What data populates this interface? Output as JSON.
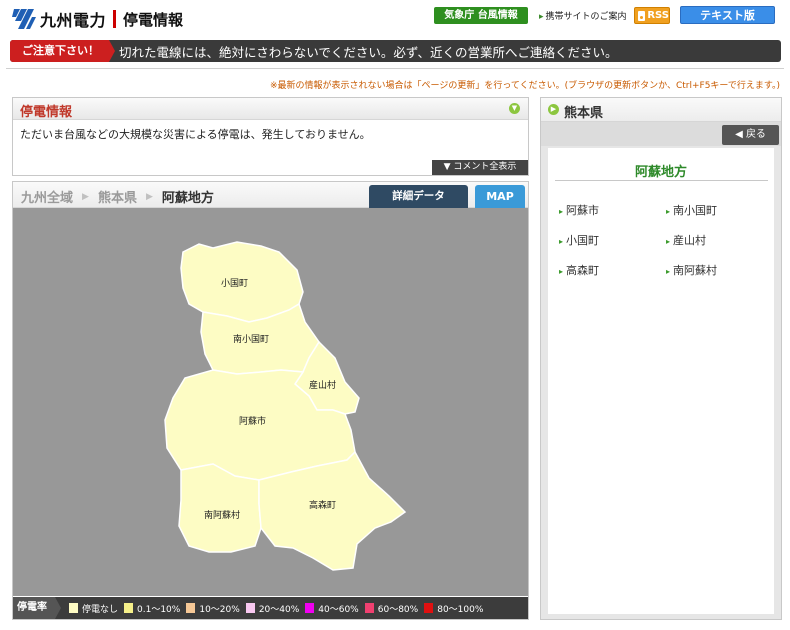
{
  "header": {
    "logo_text": "九州電力",
    "logo_sub": "停電情報",
    "jma_button": "気象庁 台風情報",
    "mobile_link": "携帯サイトのご案内",
    "rss_label": "RSS",
    "text_version_button": "テキスト版"
  },
  "warning": {
    "tag": "ご注意下さい！",
    "message": "切れた電線には、絶対にさわらないでください。必ず、近くの営業所へご連絡ください。"
  },
  "notice": "※最新の情報が表示されない場合は「ページの更新」を行ってください。(ブラウザの更新ボタンか、Ctrl+F5キーで行えます。)",
  "outage_info": {
    "title": "停電情報",
    "message": "ただいま台風などの大規模な災害による停電は、発生しておりません。",
    "comment_button": "▼ コメント全表示"
  },
  "map_panel": {
    "breadcrumb": [
      "九州全域",
      "熊本県",
      "阿蘇地方"
    ],
    "tab_detail": "詳細データ",
    "tab_map": "MAP",
    "municipalities": [
      "小国町",
      "南小国町",
      "産山村",
      "阿蘇市",
      "南阿蘇村",
      "高森町"
    ],
    "legend_title": "停電率",
    "legend": [
      {
        "label": "停電なし",
        "color": "#fffcc4"
      },
      {
        "label": "0.1〜10%",
        "color": "#f6f08a"
      },
      {
        "label": "10〜20%",
        "color": "#f6c896"
      },
      {
        "label": "20〜40%",
        "color": "#f8c8f0"
      },
      {
        "label": "40〜60%",
        "color": "#f000f0"
      },
      {
        "label": "60〜80%",
        "color": "#f04070"
      },
      {
        "label": "80〜100%",
        "color": "#e01010"
      }
    ],
    "colors": {
      "map_bg": "#989898",
      "region_fill": "#fdfcc4",
      "region_stroke": "#ffffff"
    }
  },
  "side_panel": {
    "prefecture": "熊本県",
    "back_button": "戻る",
    "region_title": "阿蘇地方",
    "towns": [
      "阿蘇市",
      "南小国町",
      "小国町",
      "産山村",
      "高森町",
      "南阿蘇村"
    ]
  }
}
